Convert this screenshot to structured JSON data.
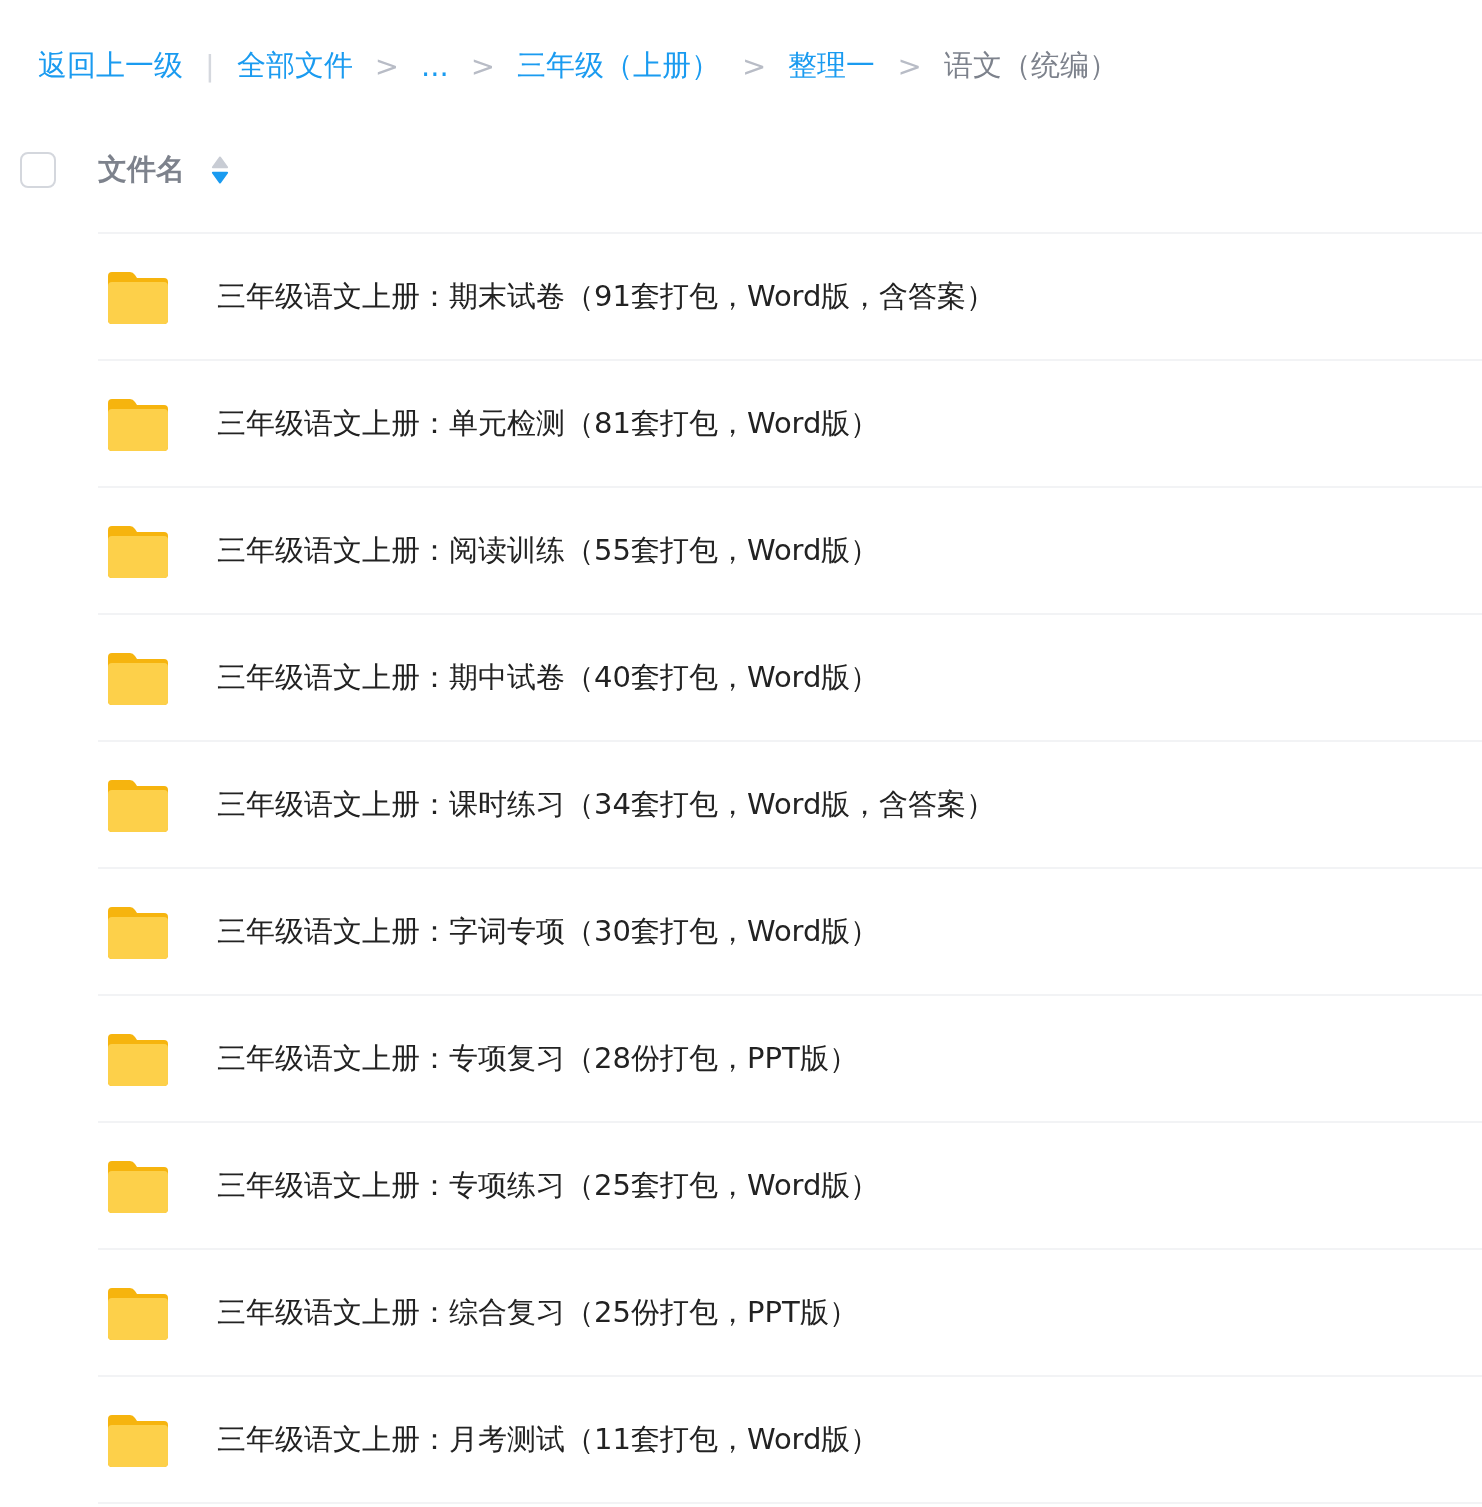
{
  "breadcrumb": [
    {
      "kind": "link",
      "text": "返回上一级"
    },
    {
      "kind": "bar",
      "text": "|"
    },
    {
      "kind": "link",
      "text": "全部文件"
    },
    {
      "kind": "sep",
      "text": ">"
    },
    {
      "kind": "link",
      "text": "..."
    },
    {
      "kind": "sep",
      "text": ">"
    },
    {
      "kind": "link",
      "text": "三年级（上册）"
    },
    {
      "kind": "sep",
      "text": ">"
    },
    {
      "kind": "link",
      "text": "整理一"
    },
    {
      "kind": "sep",
      "text": ">"
    },
    {
      "kind": "current",
      "text": "语文（统编）"
    }
  ],
  "header": {
    "checked": false,
    "label": "文件名",
    "sort_descending": true
  },
  "files": [
    {
      "name": "三年级语文上册：期末试卷（91套打包，Word版，含答案）"
    },
    {
      "name": "三年级语文上册：单元检测（81套打包，Word版）"
    },
    {
      "name": "三年级语文上册：阅读训练（55套打包，Word版）"
    },
    {
      "name": "三年级语文上册：期中试卷（40套打包，Word版）"
    },
    {
      "name": "三年级语文上册：课时练习（34套打包，Word版，含答案）"
    },
    {
      "name": "三年级语文上册：字词专项（30套打包，Word版）"
    },
    {
      "name": "三年级语文上册：专项复习（28份打包，PPT版）"
    },
    {
      "name": "三年级语文上册：专项练习（25套打包，Word版）"
    },
    {
      "name": "三年级语文上册：综合复习（25份打包，PPT版）"
    },
    {
      "name": "三年级语文上册：月考测试（11套打包，Word版）"
    }
  ]
}
